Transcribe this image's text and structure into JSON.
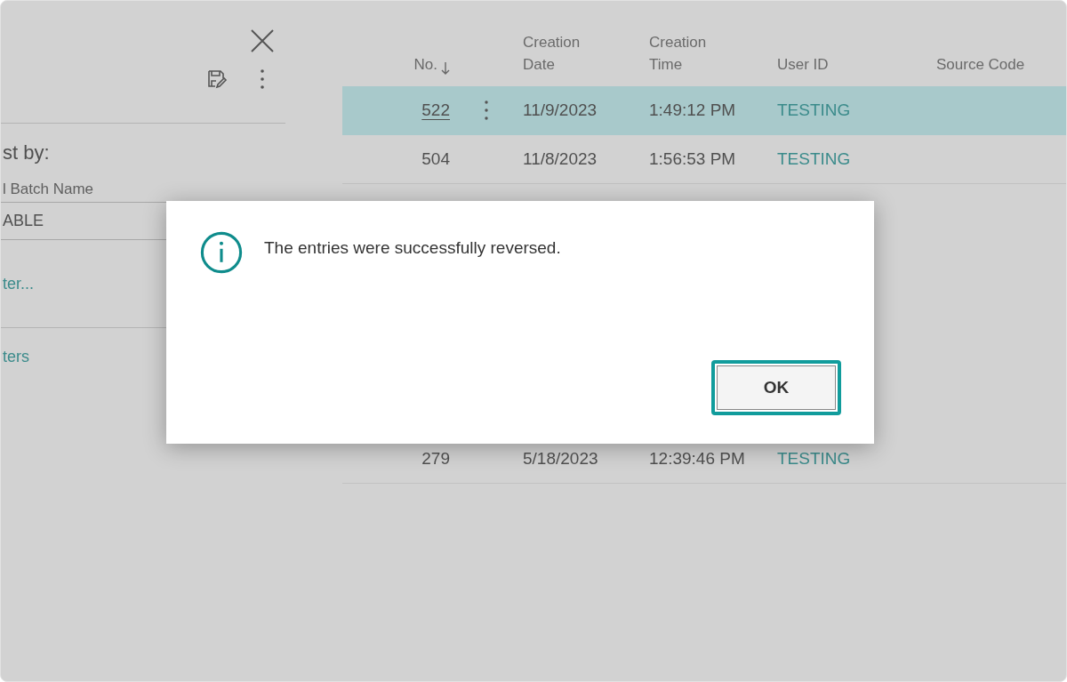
{
  "panel": {
    "heading": "st by:",
    "field": {
      "label": "l Batch Name",
      "value": "ABLE"
    },
    "links": [
      "ter...",
      "ters"
    ]
  },
  "table": {
    "columns": [
      {
        "label": "No.",
        "sorted": true
      },
      {
        "label": "Creation Date",
        "sorted": false
      },
      {
        "label": "Creation Time",
        "sorted": false
      },
      {
        "label": "User ID",
        "sorted": false
      },
      {
        "label": "Source Code",
        "sorted": false
      }
    ],
    "rows": [
      {
        "no": "522",
        "date": "11/9/2023",
        "time": "1:49:12 PM",
        "user": "TESTING",
        "selected": true
      },
      {
        "no": "504",
        "date": "11/8/2023",
        "time": "1:56:53 PM",
        "user": "TESTING",
        "selected": false
      },
      {
        "no": "279",
        "date": "5/18/2023",
        "time": "12:39:46 PM",
        "user": "TESTING",
        "selected": false
      }
    ]
  },
  "dialog": {
    "message": "The entries were successfully reversed.",
    "buttons": [
      {
        "label": "OK",
        "focused": true
      }
    ]
  }
}
